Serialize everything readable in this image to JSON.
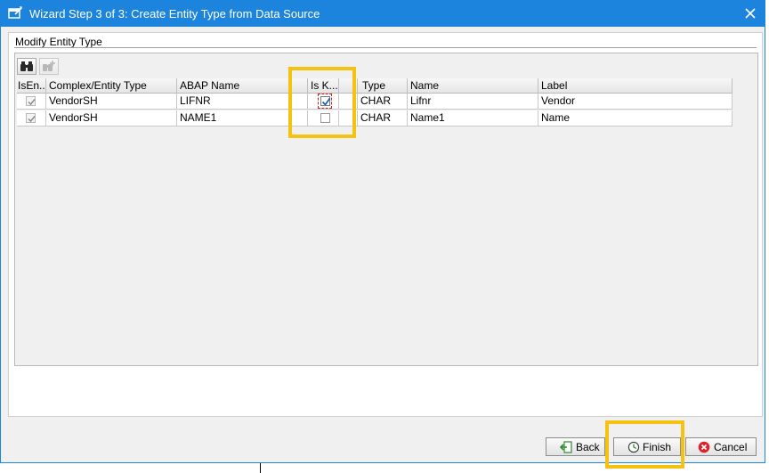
{
  "window": {
    "title": "Wizard Step 3 of 3: Create Entity Type from Data Source"
  },
  "section": {
    "title": "Modify Entity Type"
  },
  "toolbar": {
    "items": [
      {
        "icon": "binoculars-icon",
        "enabled": true
      },
      {
        "icon": "find-next-icon",
        "enabled": false
      }
    ]
  },
  "table": {
    "columns": [
      "IsEn...",
      "Complex/Entity Type",
      "ABAP Name",
      "Is K...",
      "",
      "Type",
      "Name",
      "Label"
    ],
    "rows": [
      {
        "is_entity": true,
        "complex_entity_type": "VendorSH",
        "abap_name": "LIFNR",
        "is_key": true,
        "type": "CHAR",
        "name": "Lifnr",
        "label": "Vendor"
      },
      {
        "is_entity": true,
        "complex_entity_type": "VendorSH",
        "abap_name": "NAME1",
        "is_key": false,
        "type": "CHAR",
        "name": "Name1",
        "label": "Name"
      }
    ]
  },
  "buttons": {
    "back": "Back",
    "finish": "Finish",
    "cancel": "Cancel"
  },
  "colors": {
    "title_bar": "#1c84dc",
    "highlight": "#f5c211",
    "cancel_icon": "#d9232e",
    "back_icon": "#2e8b2e"
  }
}
